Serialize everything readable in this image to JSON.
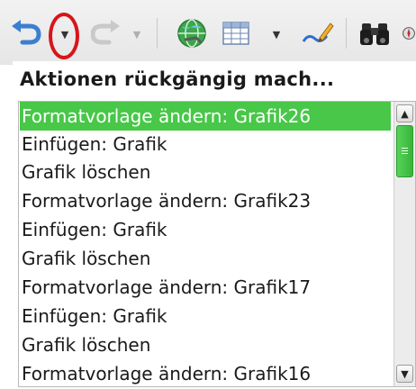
{
  "toolbar": {
    "buttons": [
      {
        "name": "undo-button",
        "icon": "undo-icon",
        "enabled": true
      },
      {
        "name": "undo-dropdown",
        "icon": "chevron-down-icon",
        "enabled": true,
        "highlighted": true
      },
      {
        "name": "redo-button",
        "icon": "redo-icon",
        "enabled": false
      },
      {
        "name": "redo-dropdown",
        "icon": "chevron-down-icon",
        "enabled": false
      },
      {
        "name": "hyperlink-button",
        "icon": "globe-icon",
        "enabled": true
      },
      {
        "name": "table-button",
        "icon": "table-icon",
        "enabled": true
      },
      {
        "name": "table-dropdown",
        "icon": "chevron-down-icon",
        "enabled": true
      },
      {
        "name": "draw-functions-button",
        "icon": "pencil-icon",
        "enabled": true
      },
      {
        "name": "find-replace-button",
        "icon": "binoculars-icon",
        "enabled": true
      }
    ],
    "highlight_color": "#d8141a"
  },
  "undo_popup": {
    "title": "Aktionen rückgängig mach...",
    "items": [
      "Formatvorlage ändern: Grafik26",
      "Einfügen: Grafik",
      "Grafik löschen",
      "Formatvorlage ändern: Grafik23",
      "Einfügen: Grafik",
      "Grafik löschen",
      "Formatvorlage ändern: Grafik17",
      "Einfügen: Grafik",
      "Grafik löschen",
      "Formatvorlage ändern: Grafik16"
    ],
    "selected_index": 0,
    "selection_color": "#48c748"
  }
}
